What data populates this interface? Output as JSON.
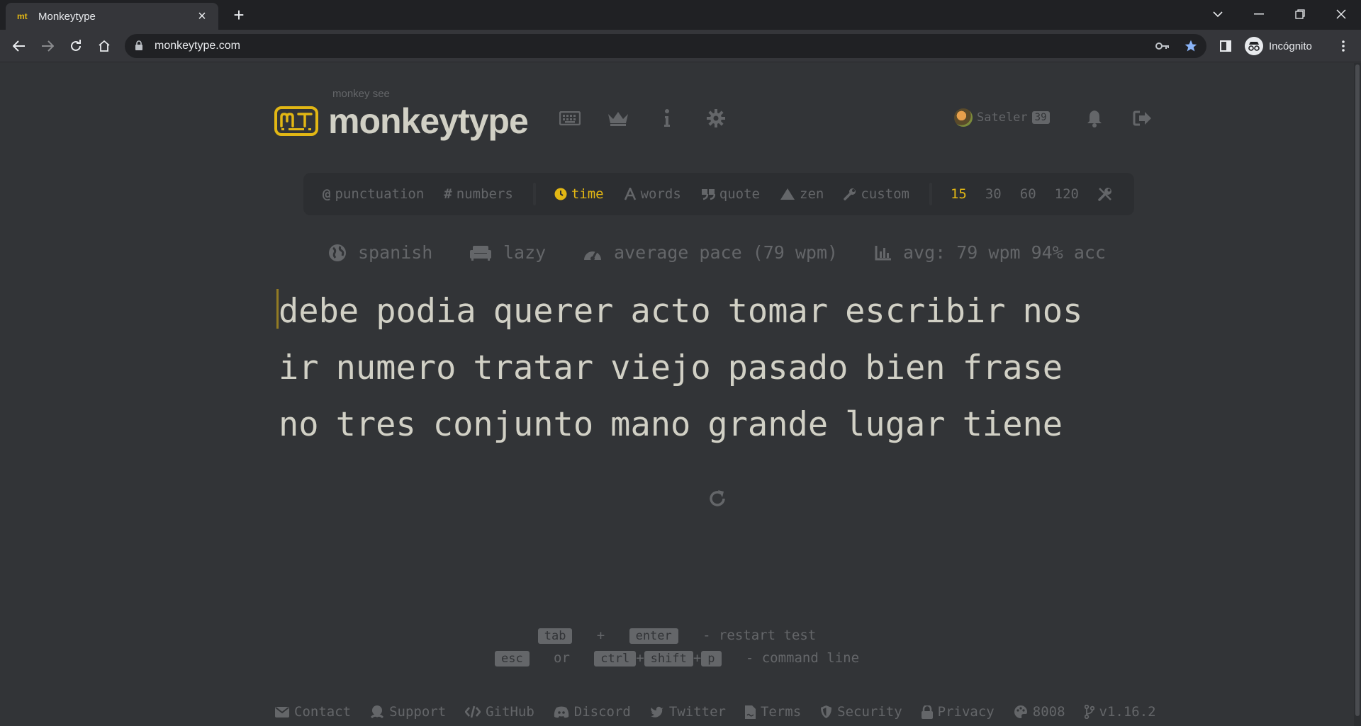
{
  "browser": {
    "tab_title": "Monkeytype",
    "tab_favicon": "mt",
    "url": "monkeytype.com",
    "profile_label": "Incógnito"
  },
  "header": {
    "logo_subtitle": "monkey see",
    "logo_title": "monkeytype",
    "nav_icons": [
      "keyboard-icon",
      "crown-icon",
      "info-icon",
      "gear-icon"
    ],
    "account": {
      "username": "Sateler",
      "level": "39"
    },
    "right_icons": [
      "bell-icon",
      "sign-out-icon"
    ]
  },
  "config": {
    "toggles": [
      {
        "icon": "@",
        "label": "punctuation"
      },
      {
        "icon": "#",
        "label": "numbers"
      }
    ],
    "modes": [
      {
        "label": "time",
        "active": true
      },
      {
        "label": "words"
      },
      {
        "label": "quote"
      },
      {
        "label": "zen"
      },
      {
        "label": "custom"
      }
    ],
    "durations": [
      "15",
      "30",
      "60",
      "120"
    ],
    "active_duration": "15"
  },
  "test_info": {
    "language": "spanish",
    "mode": "lazy",
    "pace": "average pace (79 wpm)",
    "average": "avg: 79 wpm 94% acc"
  },
  "words": {
    "line1": [
      "debe",
      "podia",
      "querer",
      "acto",
      "tomar",
      "escribir",
      "nos"
    ],
    "line2": [
      "ir",
      "numero",
      "tratar",
      "viejo",
      "pasado",
      "bien",
      "frase"
    ],
    "line3": [
      "no",
      "tres",
      "conjunto",
      "mano",
      "grande",
      "lugar",
      "tiene"
    ]
  },
  "hints": {
    "restart": {
      "key1": "tab",
      "plus": "+",
      "key2": "enter",
      "desc": "- restart test"
    },
    "command": {
      "key1": "esc",
      "or": "or",
      "key2": "ctrl",
      "key3": "shift",
      "key4": "p",
      "plus": "+",
      "desc": "- command line"
    }
  },
  "footer": {
    "contact": "Contact",
    "support": "Support",
    "github": "GitHub",
    "discord": "Discord",
    "twitter": "Twitter",
    "terms": "Terms",
    "security": "Security",
    "privacy": "Privacy",
    "theme": "8008",
    "version": "v1.16.2"
  },
  "colors": {
    "background": "#323437",
    "sub": "#646669",
    "text": "#d1d0c5",
    "accent": "#e2b714"
  }
}
